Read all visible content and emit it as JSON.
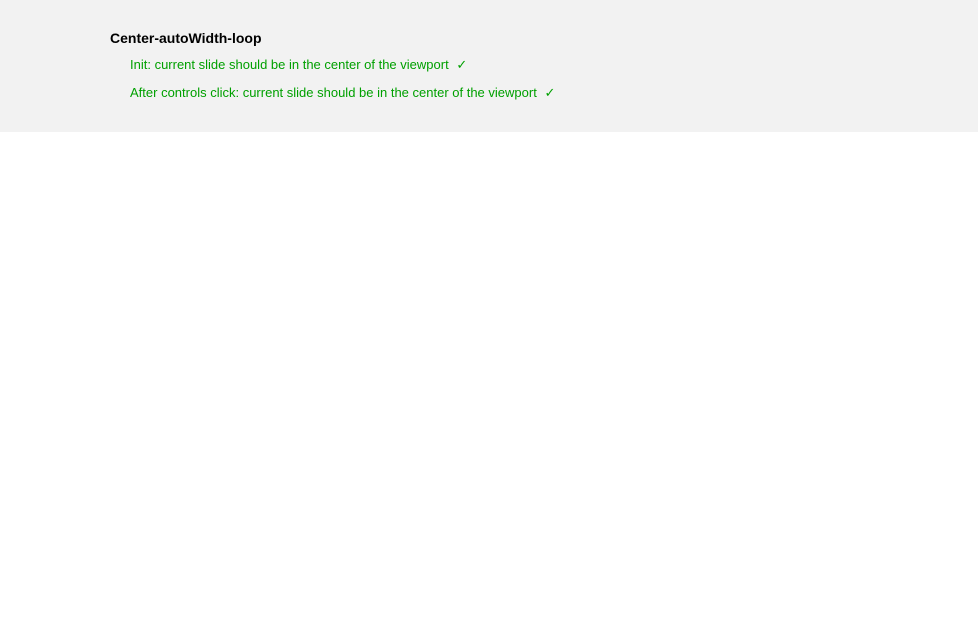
{
  "suite": {
    "title": "Center-autoWidth-loop",
    "tests": [
      {
        "label": "Init: current slide should be in the center of the viewport",
        "status_icon": "✓"
      },
      {
        "label": "After controls click: current slide should be in the center of the viewport",
        "status_icon": "✓"
      }
    ]
  }
}
